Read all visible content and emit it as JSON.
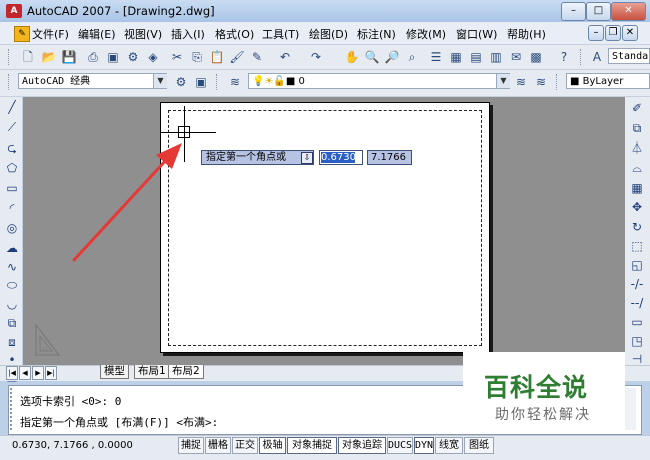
{
  "window": {
    "title": "AutoCAD 2007 - [Drawing2.dwg]",
    "app_icon_label": "A",
    "controls": {
      "minimize": "–",
      "maximize": "□",
      "close": "✕"
    }
  },
  "menubar": {
    "items": [
      "文件(F)",
      "编辑(E)",
      "视图(V)",
      "插入(I)",
      "格式(O)",
      "工具(T)",
      "绘图(D)",
      "标注(N)",
      "修改(M)",
      "窗口(W)",
      "帮助(H)"
    ],
    "doc_controls": {
      "minimize": "–",
      "restore": "❐",
      "close": "✕"
    }
  },
  "toolbar_standard": {
    "text_style_combo": "Standa"
  },
  "toolbar_workspace": {
    "workspace_combo": "AutoCAD 经典",
    "layer_combo": "0",
    "color_combo": "ByLayer"
  },
  "layout_tabs": {
    "nav": [
      "|◀",
      "◀",
      "▶",
      "▶|"
    ],
    "tabs": [
      "模型",
      "布局1",
      "布局2"
    ],
    "active": "布局2"
  },
  "dynamic_input": {
    "prompt": "指定第一个角点或",
    "prompt_icon": "⇩",
    "x_value": "0.6730",
    "y_value": "7.1766"
  },
  "command": {
    "line1": "选项卡索引 <0>: 0",
    "line2": "指定第一个角点或 [布满(F)] <布满>:"
  },
  "statusbar": {
    "coordinates": "0.6730,  7.1766 , 0.0000",
    "buttons": [
      "捕捉",
      "栅格",
      "正交",
      "极轴",
      "对象捕捉",
      "对象追踪",
      "DUCS",
      "DYN",
      "线宽",
      "图纸"
    ]
  },
  "watermark": {
    "title": "百科全说",
    "subtitle": "助你轻松解决"
  },
  "colors": {
    "canvas": "#8f8f8f",
    "arrow": "#e53935",
    "watermark_green": "#2e7d32"
  }
}
